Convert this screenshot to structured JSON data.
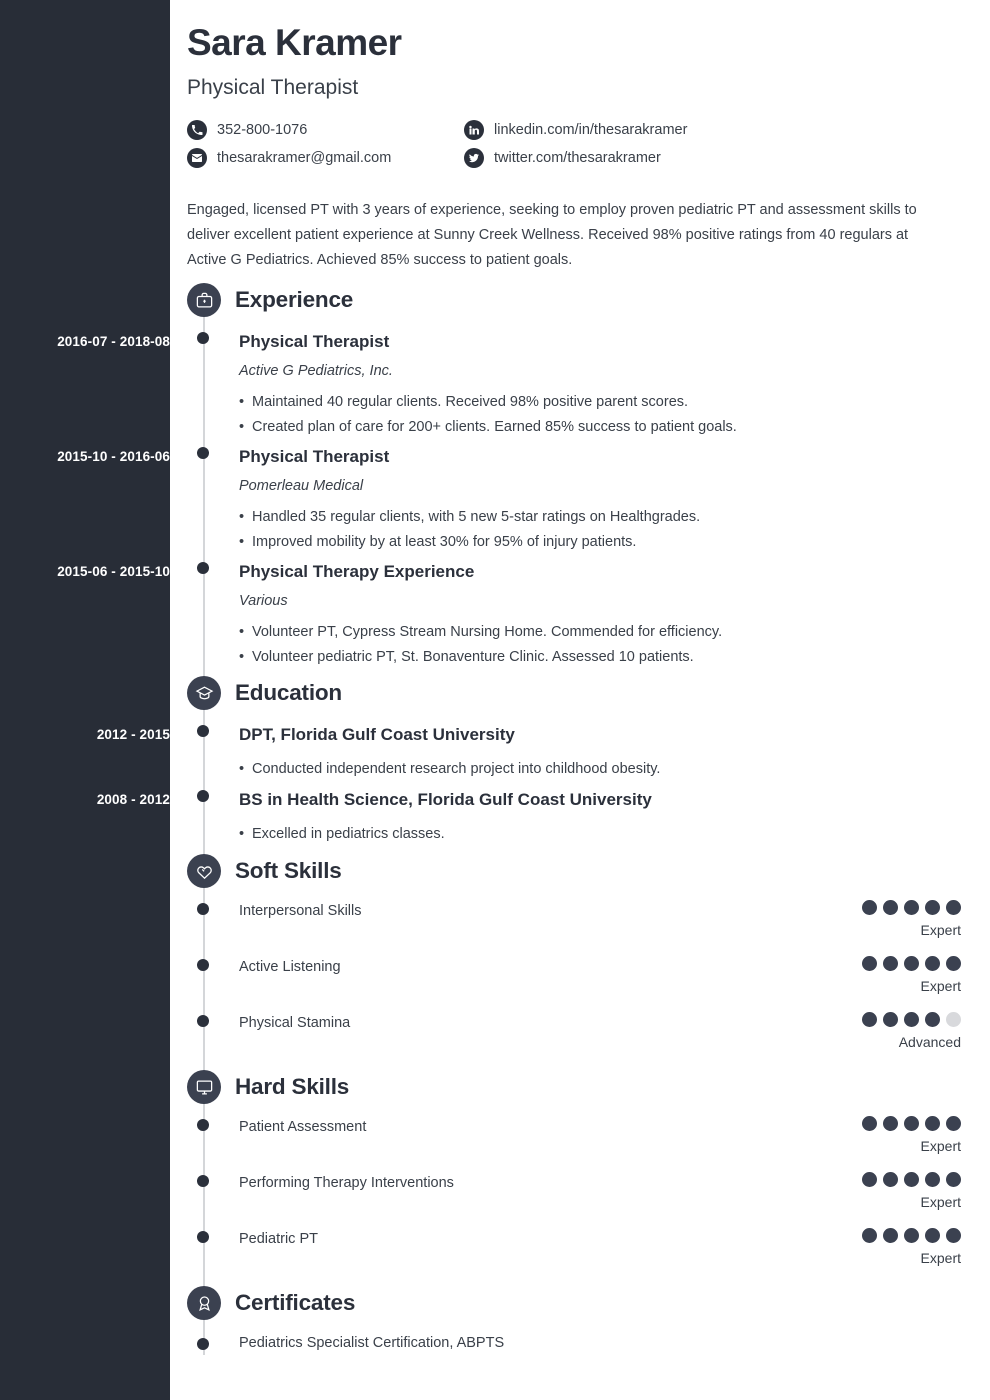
{
  "theme": {
    "sidebar_bg": "#282d37",
    "page_bg": "#ffffff",
    "text": "#3a4049",
    "heading": "#2b303b",
    "icon_bg": "#3b4150",
    "pip_on": "#3b4150",
    "pip_off": "#d8d9dc",
    "rail": "#d4d6d9"
  },
  "header": {
    "name": "Sara Kramer",
    "job_title": "Physical Therapist",
    "contacts": [
      {
        "icon": "phone-icon",
        "text": "352-800-1076"
      },
      {
        "icon": "linkedin-icon",
        "text": "linkedin.com/in/thesarakramer"
      },
      {
        "icon": "email-icon",
        "text": "thesarakramer@gmail.com"
      },
      {
        "icon": "twitter-icon",
        "text": "twitter.com/thesarakramer"
      }
    ]
  },
  "summary": "Engaged, licensed PT with 3 years of experience, seeking to employ proven pediatric PT and assessment skills to deliver excellent patient experience at Sunny Creek Wellness. Received 98% positive ratings from 40 regulars at Active G Pediatrics. Achieved 85% success to patient goals.",
  "sections": {
    "experience": {
      "title": "Experience",
      "icon": "briefcase-icon",
      "entries": [
        {
          "date": "2016-07 - 2018-08",
          "title": "Physical Therapist",
          "subtitle": "Active G Pediatrics, Inc.",
          "bullets": [
            "Maintained 40 regular clients. Received 98% positive parent scores.",
            "Created plan of care for 200+ clients. Earned 85% success to patient goals."
          ]
        },
        {
          "date": "2015-10 - 2016-06",
          "title": "Physical Therapist",
          "subtitle": "Pomerleau Medical",
          "bullets": [
            "Handled 35 regular clients, with 5 new 5-star ratings on Healthgrades.",
            "Improved mobility by at least 30% for 95% of injury patients."
          ]
        },
        {
          "date": "2015-06 - 2015-10",
          "title": "Physical Therapy Experience",
          "subtitle": "Various",
          "bullets": [
            "Volunteer PT, Cypress Stream Nursing Home. Commended for efficiency.",
            "Volunteer pediatric PT, St. Bonaventure Clinic. Assessed 10 patients."
          ]
        }
      ]
    },
    "education": {
      "title": "Education",
      "icon": "graduation-cap-icon",
      "entries": [
        {
          "date": "2012 - 2015",
          "title": "DPT, Florida Gulf Coast University",
          "bullets": [
            "Conducted independent research project into childhood obesity."
          ]
        },
        {
          "date": "2008 - 2012",
          "title": "BS in Health Science, Florida Gulf Coast University",
          "bullets": [
            "Excelled in pediatrics classes."
          ]
        }
      ]
    },
    "soft_skills": {
      "title": "Soft Skills",
      "icon": "heart-hand-icon",
      "max_pips": 5,
      "items": [
        {
          "name": "Interpersonal Skills",
          "filled": 5,
          "level": "Expert"
        },
        {
          "name": "Active Listening",
          "filled": 5,
          "level": "Expert"
        },
        {
          "name": "Physical Stamina",
          "filled": 4,
          "level": "Advanced"
        }
      ]
    },
    "hard_skills": {
      "title": "Hard Skills",
      "icon": "monitor-icon",
      "max_pips": 5,
      "items": [
        {
          "name": "Patient Assessment",
          "filled": 5,
          "level": "Expert"
        },
        {
          "name": "Performing Therapy Interventions",
          "filled": 5,
          "level": "Expert"
        },
        {
          "name": "Pediatric PT",
          "filled": 5,
          "level": "Expert"
        }
      ]
    },
    "certificates": {
      "title": "Certificates",
      "icon": "award-ribbon-icon",
      "items": [
        "Pediatrics Specialist Certification, ABPTS"
      ]
    }
  }
}
